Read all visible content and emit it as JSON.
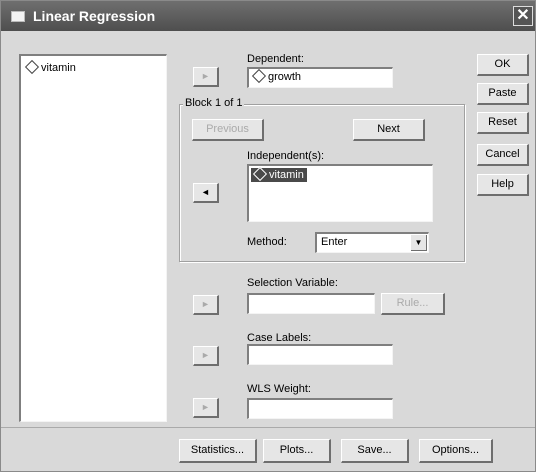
{
  "window": {
    "title": "Linear Regression",
    "close_label": "✕"
  },
  "variables": [
    {
      "name": "vitamin"
    }
  ],
  "dependent": {
    "label": "Dependent:",
    "value": "growth"
  },
  "block": {
    "label": "Block 1 of 1",
    "previous_label": "Previous",
    "next_label": "Next"
  },
  "independents": {
    "label": "Independent(s):",
    "items": [
      "vitamin"
    ]
  },
  "method": {
    "label": "Method:",
    "value": "Enter"
  },
  "selection_variable": {
    "label": "Selection Variable:",
    "value": "",
    "rule_label": "Rule..."
  },
  "case_labels": {
    "label": "Case Labels:",
    "value": ""
  },
  "wls_weight": {
    "label": "WLS Weight:",
    "value": ""
  },
  "side_buttons": {
    "ok": "OK",
    "paste": "Paste",
    "reset": "Reset",
    "cancel": "Cancel",
    "help": "Help"
  },
  "bottom_buttons": {
    "statistics": "Statistics...",
    "plots": "Plots...",
    "save": "Save...",
    "options": "Options..."
  }
}
